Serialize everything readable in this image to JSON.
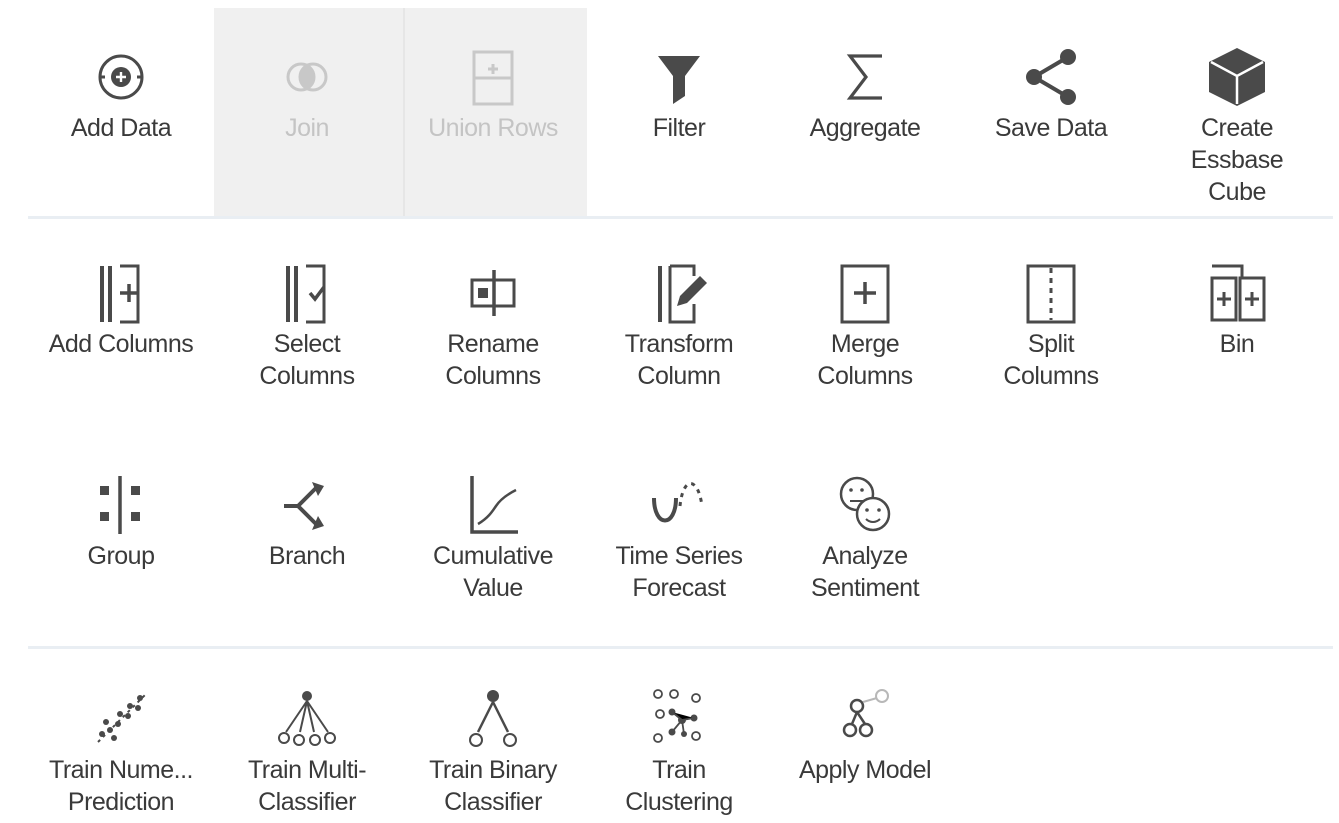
{
  "sections": {
    "basic": {
      "items": [
        {
          "label": "Add Data",
          "icon": "add-data-icon",
          "enabled": true
        },
        {
          "label": "Join",
          "icon": "join-icon",
          "enabled": false
        },
        {
          "label": "Union Rows",
          "icon": "union-rows-icon",
          "enabled": false
        },
        {
          "label": "Filter",
          "icon": "filter-icon",
          "enabled": true
        },
        {
          "label": "Aggregate",
          "icon": "sigma-icon",
          "enabled": true
        },
        {
          "label": "Save Data",
          "icon": "share-icon",
          "enabled": true
        },
        {
          "label": "Create Essbase Cube",
          "icon": "cube-icon",
          "enabled": true
        }
      ]
    },
    "columns": {
      "items": [
        {
          "label": "Add Columns",
          "icon": "add-columns-icon"
        },
        {
          "label": "Select Columns",
          "icon": "select-columns-icon"
        },
        {
          "label": "Rename Columns",
          "icon": "rename-columns-icon"
        },
        {
          "label": "Transform Column",
          "icon": "transform-column-icon"
        },
        {
          "label": "Merge Columns",
          "icon": "merge-columns-icon"
        },
        {
          "label": "Split Columns",
          "icon": "split-columns-icon"
        },
        {
          "label": "Bin",
          "icon": "bin-icon"
        }
      ]
    },
    "analytics": {
      "items": [
        {
          "label": "Group",
          "icon": "group-icon"
        },
        {
          "label": "Branch",
          "icon": "branch-icon"
        },
        {
          "label": "Cumulative Value",
          "icon": "cumulative-value-icon"
        },
        {
          "label": "Time Series Forecast",
          "icon": "time-series-icon"
        },
        {
          "label": "Analyze Sentiment",
          "icon": "sentiment-icon"
        }
      ]
    },
    "ml": {
      "items": [
        {
          "label": "Train Nume... Prediction",
          "icon": "numeric-prediction-icon"
        },
        {
          "label": "Train Multi-Classifier",
          "icon": "multi-classifier-icon"
        },
        {
          "label": "Train Binary Classifier",
          "icon": "binary-classifier-icon"
        },
        {
          "label": "Train Clustering",
          "icon": "clustering-icon"
        },
        {
          "label": "Apply Model",
          "icon": "apply-model-icon"
        }
      ]
    }
  },
  "colors": {
    "icon": "#4a4a4a",
    "disabled_icon": "#c8c8c8",
    "disabled_bg": "#f0f0f0",
    "divider": "#e9eef3"
  }
}
